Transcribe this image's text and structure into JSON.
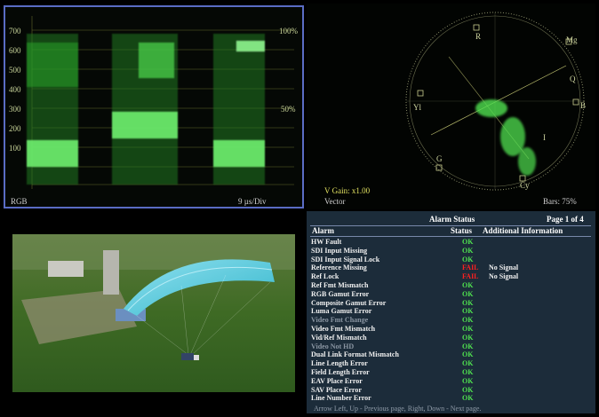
{
  "waveform": {
    "y_ticks": [
      "700",
      "600",
      "500",
      "400",
      "300",
      "200",
      "100"
    ],
    "pct_100": "100%",
    "pct_50": "50%",
    "mode": "RGB",
    "timebase": "9 µs/Div",
    "trace_color": "#3fdc3f"
  },
  "vectorscope": {
    "targets": [
      "R",
      "Mg",
      "B",
      "Cy",
      "G",
      "Yl"
    ],
    "small_labels": [
      "I",
      "Q"
    ],
    "gain": "V Gain: x1.00",
    "name": "Vector",
    "bars": "Bars: 75%"
  },
  "alarm": {
    "title": "Alarm Status",
    "page": "Page 1 of 4",
    "col_alarm": "Alarm",
    "col_status": "Status",
    "col_info": "Additional Information",
    "rows": [
      {
        "name": "HW Fault",
        "status": "OK",
        "info": "",
        "dim": false
      },
      {
        "name": "SDI Input Missing",
        "status": "OK",
        "info": "",
        "dim": false
      },
      {
        "name": "SDI Input Signal Lock",
        "status": "OK",
        "info": "",
        "dim": false
      },
      {
        "name": "Reference Missing",
        "status": "FAIL",
        "info": "No Signal",
        "dim": false
      },
      {
        "name": "Ref Lock",
        "status": "FAIL",
        "info": "No Signal",
        "dim": false
      },
      {
        "name": "Ref Fmt Mismatch",
        "status": "OK",
        "info": "",
        "dim": false
      },
      {
        "name": "RGB Gamut Error",
        "status": "OK",
        "info": "",
        "dim": false
      },
      {
        "name": "Composite Gamut Error",
        "status": "OK",
        "info": "",
        "dim": false
      },
      {
        "name": "Luma Gamut Error",
        "status": "OK",
        "info": "",
        "dim": false
      },
      {
        "name": "Video Fmt Change",
        "status": "OK",
        "info": "",
        "dim": true
      },
      {
        "name": "Video Fmt Mismatch",
        "status": "OK",
        "info": "",
        "dim": false
      },
      {
        "name": "Vid/Ref Mismatch",
        "status": "OK",
        "info": "",
        "dim": false
      },
      {
        "name": "Video Not HD",
        "status": "OK",
        "info": "",
        "dim": true
      },
      {
        "name": "Dual Link Format Mismatch",
        "status": "OK",
        "info": "",
        "dim": false
      },
      {
        "name": "Line Length Error",
        "status": "OK",
        "info": "",
        "dim": false
      },
      {
        "name": "Field Length Error",
        "status": "OK",
        "info": "",
        "dim": false
      },
      {
        "name": "EAV Place Error",
        "status": "OK",
        "info": "",
        "dim": false
      },
      {
        "name": "SAV Place Error",
        "status": "OK",
        "info": "",
        "dim": false
      },
      {
        "name": "Line Number Error",
        "status": "OK",
        "info": "",
        "dim": false
      }
    ],
    "footer": "Arrow Left, Up - Previous page, Right, Down - Next page."
  }
}
